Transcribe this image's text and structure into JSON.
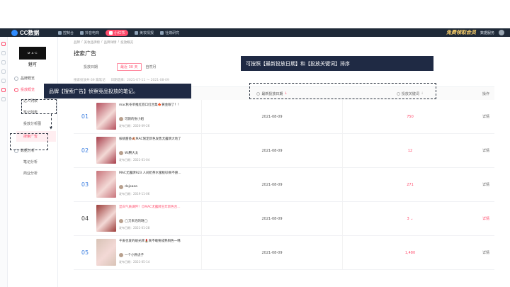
{
  "topbar": {
    "logo": "CC数据",
    "nav": [
      {
        "label": "控制台",
        "active": false
      },
      {
        "label": "抖音电商",
        "active": false
      },
      {
        "label": "小红书",
        "active": true
      },
      {
        "label": "美妆情报",
        "active": false
      },
      {
        "label": "社媒研究",
        "active": false
      }
    ],
    "slogan": "免费领取会员",
    "account": "数据服务"
  },
  "sidebar": {
    "brand_logo": "M·A·C",
    "brand_name": "魅可",
    "items": [
      {
        "label": "品牌概览",
        "type": "item"
      },
      {
        "label": "投放概览",
        "type": "item",
        "active": true
      },
      {
        "label": "达人列表",
        "type": "sub"
      },
      {
        "label": "笔记列表",
        "type": "sub"
      },
      {
        "label": "投放分析图",
        "type": "sub"
      },
      {
        "label": "搜索广告",
        "type": "sub",
        "selected": true
      },
      {
        "label": "数据分析",
        "type": "item"
      },
      {
        "label": "笔记分析",
        "type": "sub"
      },
      {
        "label": "商业分析",
        "type": "sub"
      }
    ]
  },
  "breadcrumb": [
    "品牌",
    "美妆品牌榜",
    "品牌详情",
    "投放概览"
  ],
  "page_title": "搜索广告",
  "filter": {
    "label": "投放日期",
    "chip_selected": "最近 30 天",
    "chip_other": "自然月"
  },
  "info": {
    "count_text": "搜索投放共 69 篇笔记",
    "range_text": "日期选择：2021-07-11 ～ 2021-08-09"
  },
  "table": {
    "headers": {
      "note": "",
      "date": "最新投放日期",
      "keyword": "投放关键词",
      "op": "操作"
    },
    "rows": [
      {
        "idx": "01",
        "title": "mac秋冬单推红唇口红合集🍁黄金眼了！！",
        "author": "可颜的张小姐",
        "published": "发布日期：2020-09-26",
        "date": "2021-08-09",
        "keyword": "750",
        "op": "详情",
        "hot": false,
        "thumb": "#b5505e"
      },
      {
        "idx": "02",
        "title": "核桃甜香🍂MAC限定新色发售尤露牌大地了",
        "author": "Wi腾大太",
        "published": "发布日期：2021-01-04",
        "date": "2021-08-09",
        "keyword": "12",
        "op": "详情",
        "hot": false,
        "thumb": "#a63d4a"
      },
      {
        "idx": "03",
        "title": "MAC尤露牌923 人间奶茶水蜜桃🐱真不愿...",
        "author": "dojoaaa",
        "published": "发布日期：2019-11-06",
        "date": "2021-08-09",
        "keyword": "271",
        "op": "详情",
        "hot": false,
        "thumb": "#c8737a"
      },
      {
        "idx": "04",
        "title": "显白气质满怀！😊MAC尤露牌王炸新色合...",
        "author": "◯刀未泡的呀◯",
        "published": "发布日期：2021-01-28",
        "date": "2021-08-09",
        "keyword": "3 ⌄",
        "op": "详情",
        "hot": true,
        "thumb": "#9c3d3a"
      },
      {
        "idx": "05",
        "title": "干皮也爱的蜕光牌💄真不敢要成熟铜色一韩",
        "author": "一个小胖虎子",
        "published": "发布日期：2021-05-14",
        "date": "2021-08-09",
        "keyword": "1,480",
        "op": "详情",
        "hot": false,
        "thumb": "#d8c3b6"
      }
    ]
  },
  "annotations": {
    "left_note": "品牌【搜索广告】侦察竞品投放的笔记。",
    "right_note": "可按照【最新投放日期】和【投放关键词】排序"
  }
}
